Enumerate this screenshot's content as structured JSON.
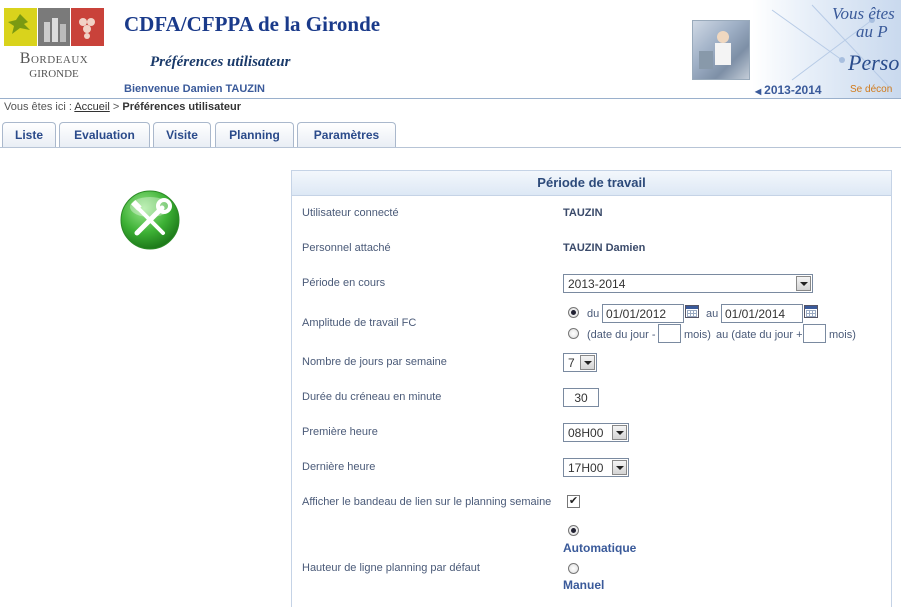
{
  "header": {
    "logo_line1": "Bordeaux",
    "logo_line2": "GIRONDE",
    "site_title": "CDFA/CFPPA de la Gironde",
    "page_subtitle": "Préférences utilisateur",
    "welcome": "Bienvenue Damien TAUZIN",
    "brand_line1": "Vous êtes",
    "brand_line2": "au P",
    "brand_line3": "Perso",
    "logout_text": "Se décon",
    "year": "2013-2014",
    "year_arrow_icon": "caret-left-icon"
  },
  "breadcrumb": {
    "prefix": "Vous êtes ici :",
    "home": "Accueil",
    "separator": ">",
    "current": "Préférences utilisateur"
  },
  "tabs": [
    "Liste",
    "Evaluation",
    "Visite",
    "Planning",
    "Paramètres"
  ],
  "panel": {
    "title": "Période de travail",
    "user_label": "Utilisateur connecté",
    "user_value": "TAUZIN",
    "staff_label": "Personnel attaché",
    "staff_value": "TAUZIN Damien",
    "period_label": "Période en cours",
    "period_value": "2013-2014",
    "amplitude_label": "Amplitude de travail FC",
    "du": "du",
    "date_from": "01/01/2012",
    "au": "au",
    "date_to": "01/01/2014",
    "rel_from": "(date du jour -",
    "rel_months1": "mois)",
    "rel_to": "au (date du jour +",
    "rel_months2": "mois)",
    "days_label": "Nombre de jours par semaine",
    "days_value": "7",
    "slot_label": "Durée du créneau en minute",
    "slot_value": "30",
    "first_hour_label": "Première heure",
    "first_hour_value": "08H00",
    "last_hour_label": "Dernière heure",
    "last_hour_value": "17H00",
    "banner_label": "Afficher le bandeau de lien sur le planning semaine",
    "banner_checked": "✔",
    "row_height_label": "Hauteur de ligne planning par défaut",
    "auto_label": "Automatique",
    "manual_label": "Manuel"
  },
  "colors": {
    "accent": "#1a3a8a",
    "link": "#3a5a9a",
    "logout": "#d17a1a",
    "tool_icon": "#3cb034"
  }
}
